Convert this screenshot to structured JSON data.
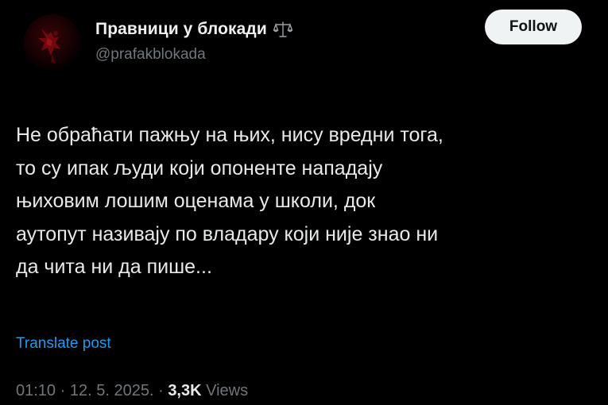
{
  "author": {
    "display_name": "Правници у блокади",
    "handle": "@prafakblokada",
    "badge_icon": "scales-icon",
    "avatar_color": "#3a0407"
  },
  "follow_button": {
    "label": "Follow"
  },
  "tweet": {
    "lines": [
      "Не обраћати пажњу на њих, нису вредни тога,",
      "то су ипак људи који опоненте нападају",
      "њиховим лошим оценама у школи, док",
      "аутопут називају по владару који није знао ни",
      "да чита ни да пише..."
    ]
  },
  "translate_link": "Translate post",
  "meta": {
    "time": "01:10",
    "separator": "·",
    "date": "12. 5. 2025.",
    "views_count": "3,3K",
    "views_label": "Views"
  },
  "colors": {
    "background": "#000000",
    "text": "#e7e9ea",
    "muted": "#71767b",
    "link": "#1d9bf0",
    "button_bg": "#eff3f4"
  }
}
